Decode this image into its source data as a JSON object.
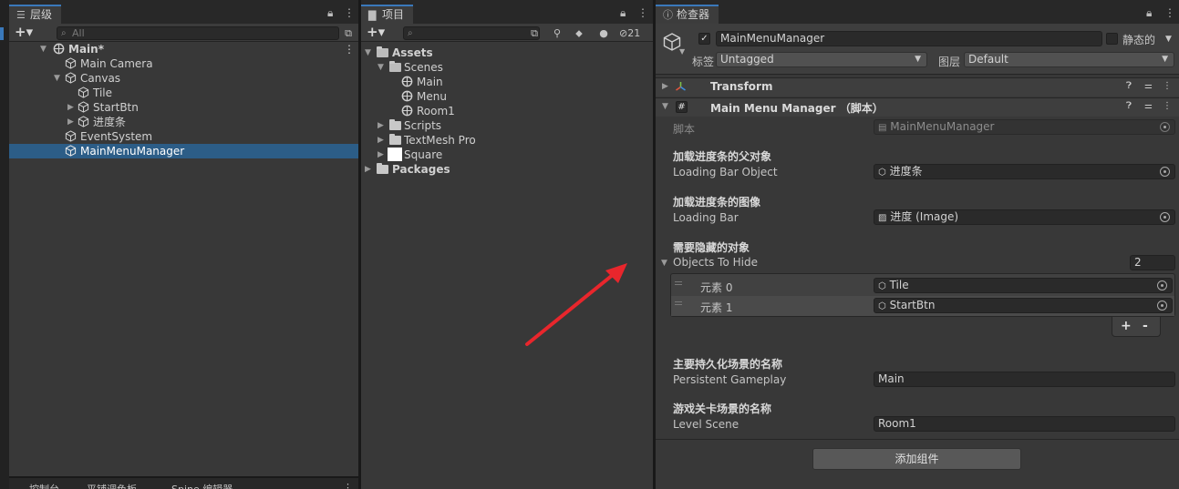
{
  "hierarchy": {
    "tab_label": "层级",
    "search_placeholder": "All",
    "items": [
      {
        "label": "Main*"
      },
      {
        "label": "Main Camera"
      },
      {
        "label": "Canvas"
      },
      {
        "label": "Tile"
      },
      {
        "label": "StartBtn"
      },
      {
        "label": "进度条"
      },
      {
        "label": "EventSystem"
      },
      {
        "label": "MainMenuManager"
      }
    ]
  },
  "project": {
    "tab_label": "项目",
    "hidden_count": "21",
    "items": [
      {
        "label": "Assets"
      },
      {
        "label": "Scenes"
      },
      {
        "label": "Main"
      },
      {
        "label": "Menu"
      },
      {
        "label": "Room1"
      },
      {
        "label": "Scripts"
      },
      {
        "label": "TextMesh Pro"
      },
      {
        "label": "Square"
      },
      {
        "label": "Packages"
      }
    ]
  },
  "inspector": {
    "tab_label": "检查器",
    "object_name": "MainMenuManager",
    "static_label": "静态的",
    "tag_label": "标签",
    "tag_value": "Untagged",
    "layer_label": "图层",
    "layer_value": "Default",
    "transform_title": "Transform",
    "component_title": "Main Menu Manager （脚本）",
    "script_label": "脚本",
    "script_value": "MainMenuManager",
    "props": {
      "loading_bar_object": {
        "header": "加载进度条的父对象",
        "label": "Loading Bar Object",
        "value": "进度条"
      },
      "loading_bar": {
        "header": "加载进度条的图像",
        "label": "Loading Bar",
        "value": "进度 (Image)"
      },
      "objects_to_hide": {
        "header": "需要隐藏的对象",
        "label": "Objects To Hide",
        "size": "2",
        "elements": [
          {
            "label": "元素 0",
            "value": "Tile"
          },
          {
            "label": "元素 1",
            "value": "StartBtn"
          }
        ]
      },
      "persistent_gameplay": {
        "header": "主要持久化场景的名称",
        "label": "Persistent Gameplay",
        "value": "Main"
      },
      "level_scene": {
        "header": "游戏关卡场景的名称",
        "label": "Level Scene",
        "value": "Room1"
      }
    },
    "add_plus": "+",
    "add_minus": "-",
    "add_component_label": "添加组件"
  },
  "bottom_tabs": {
    "console": "控制台",
    "flat": "平铺调色板",
    "spine": "Spine 编辑器"
  },
  "annotation": {
    "arrow_color": "#e8262c"
  }
}
